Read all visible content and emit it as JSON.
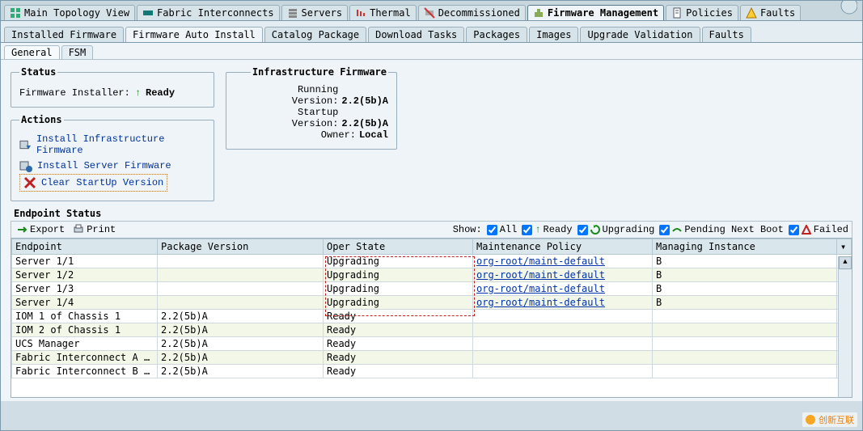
{
  "main_tabs": [
    {
      "label": "Main Topology View",
      "active": false
    },
    {
      "label": "Fabric Interconnects",
      "active": false
    },
    {
      "label": "Servers",
      "active": false
    },
    {
      "label": "Thermal",
      "active": false
    },
    {
      "label": "Decommissioned",
      "active": false
    },
    {
      "label": "Firmware Management",
      "active": true
    },
    {
      "label": "Policies",
      "active": false
    },
    {
      "label": "Faults",
      "active": false
    }
  ],
  "sub_tabs": [
    {
      "label": "Installed Firmware",
      "active": false
    },
    {
      "label": "Firmware Auto Install",
      "active": true
    },
    {
      "label": "Catalog Package",
      "active": false
    },
    {
      "label": "Download Tasks",
      "active": false
    },
    {
      "label": "Packages",
      "active": false
    },
    {
      "label": "Images",
      "active": false
    },
    {
      "label": "Upgrade Validation",
      "active": false
    },
    {
      "label": "Faults",
      "active": false
    }
  ],
  "subsub_tabs": [
    {
      "label": "General",
      "active": true
    },
    {
      "label": "FSM",
      "active": false
    }
  ],
  "status": {
    "legend": "Status",
    "installer_label": "Firmware Installer:",
    "installer_state": "Ready"
  },
  "actions": {
    "legend": "Actions",
    "install_infra": "Install Infrastructure Firmware",
    "install_server": "Install Server Firmware",
    "clear_startup": "Clear StartUp Version"
  },
  "infra": {
    "legend": "Infrastructure Firmware",
    "running_label": "Running Version:",
    "running_value": "2.2(5b)A",
    "startup_label": "Startup Version:",
    "startup_value": "2.2(5b)A",
    "owner_label": "Owner:",
    "owner_value": "Local"
  },
  "endpoint_title": "Endpoint Status",
  "toolbar": {
    "export": "Export",
    "print": "Print",
    "show": "Show:",
    "all": "All",
    "ready": "Ready",
    "upgrading": "Upgrading",
    "pending": "Pending Next Boot",
    "failed": "Failed"
  },
  "columns": {
    "endpoint": "Endpoint",
    "package": "Package Version",
    "oper": "Oper State",
    "maint": "Maintenance Policy",
    "managing": "Managing Instance"
  },
  "rows": [
    {
      "endpoint": "Server 1/1",
      "package": "",
      "oper": "Upgrading",
      "maint": "org-root/maint-default",
      "managing": "B",
      "link": true
    },
    {
      "endpoint": "Server 1/2",
      "package": "",
      "oper": "Upgrading",
      "maint": "org-root/maint-default",
      "managing": "B",
      "link": true
    },
    {
      "endpoint": "Server 1/3",
      "package": "",
      "oper": "Upgrading",
      "maint": "org-root/maint-default",
      "managing": "B",
      "link": true
    },
    {
      "endpoint": "Server 1/4",
      "package": "",
      "oper": "Upgrading",
      "maint": "org-root/maint-default",
      "managing": "B",
      "link": true
    },
    {
      "endpoint": "IOM 1 of Chassis 1",
      "package": "2.2(5b)A",
      "oper": "Ready",
      "maint": "",
      "managing": "",
      "link": false
    },
    {
      "endpoint": "IOM 2 of Chassis 1",
      "package": "2.2(5b)A",
      "oper": "Ready",
      "maint": "",
      "managing": "",
      "link": false
    },
    {
      "endpoint": "UCS Manager",
      "package": "2.2(5b)A",
      "oper": "Ready",
      "maint": "",
      "managing": "",
      "link": false
    },
    {
      "endpoint": "Fabric Interconnect A (sub...",
      "package": "2.2(5b)A",
      "oper": "Ready",
      "maint": "",
      "managing": "",
      "link": false
    },
    {
      "endpoint": "Fabric Interconnect B (pri...",
      "package": "2.2(5b)A",
      "oper": "Ready",
      "maint": "",
      "managing": "",
      "link": false
    }
  ],
  "watermark": "创新互联"
}
